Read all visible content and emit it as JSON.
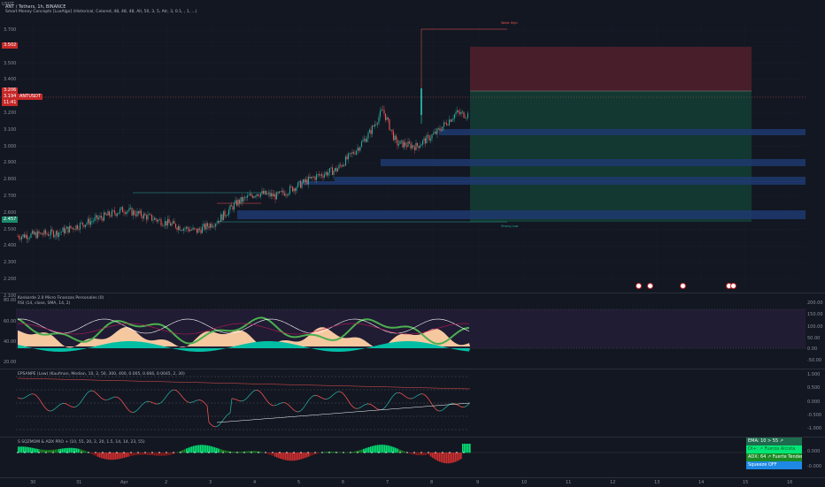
{
  "header": {
    "currency": "USDT",
    "symbol_line": "ANT / Tethers, 1h, BINANCE",
    "indicator_line": "Smart Money Concepts [LuxAlgo] (Historical, Colored, 48, 48, 48, All, 50, 3, 5, Atr, 3, 0.1, , 1, ...)"
  },
  "price_axis": {
    "ticks": [
      "3.700",
      "3.600",
      "3.500",
      "3.400",
      "3.300",
      "3.200",
      "3.100",
      "3.000",
      "2.900",
      "2.800",
      "2.700",
      "2.600",
      "2.500",
      "2.400",
      "2.300",
      "2.200",
      "2.100"
    ],
    "badge_top": "3.502",
    "badge_mid_1": "3.206",
    "badge_current": "3.194",
    "badge_current_sub": "11:41",
    "badge_symbol": "ANTUSDT",
    "badge_low": "2.457"
  },
  "chart_labels": {
    "weak_high": "Weak High",
    "strong_low": "Strong Low"
  },
  "konkorde": {
    "title": "Konkorde 2.0 Micro Finanzas Personales (0)",
    "subtitle": "RSI (14, close, SMA, 14, 2)",
    "left_ticks": [
      "80.00",
      "60.00",
      "40.00",
      "20.00"
    ],
    "right_ticks": [
      "200.00",
      "150.00",
      "100.00",
      "50.00",
      "0.00",
      "-50.00"
    ]
  },
  "epsanpe": {
    "title": "EPSANPE (Low) (Kaufman, Median, 10, 2, 50, 300, 400, 0.005, 0.666, 0.0045, 2, 30)",
    "right_ticks": [
      "1.000",
      "0.500",
      "0.000",
      "-0.500",
      "-1.000"
    ]
  },
  "sqzmom": {
    "title": "S SQZMOM & ADX PRO + (10, 55, 20, 2, 20, 1.5, 14, 14, 23, 55)",
    "right_ticks": [
      "0.000",
      "-0.000"
    ],
    "table": [
      {
        "text": "EMA: 10 > 55 ↗",
        "bg": "#1e6b4e",
        "fg": "#ffffff"
      },
      {
        "text": "DI+: ↗ Fuerza Alcista",
        "bg": "#00e676",
        "fg": "#1b5e20"
      },
      {
        "text": "ADX: 64 ↗ Fuerte Tendencia",
        "bg": "#1b8a24",
        "fg": "#ffffff"
      },
      {
        "text": "Squeeze OFF",
        "bg": "#1e88e5",
        "fg": "#ffffff"
      }
    ]
  },
  "time_axis": {
    "labels": [
      "30",
      "31",
      "Apr",
      "2",
      "3",
      "4",
      "5",
      "6",
      "7",
      "8",
      "9",
      "10",
      "11",
      "12",
      "13",
      "14",
      "15",
      "16"
    ]
  },
  "colors": {
    "bg": "#131722",
    "up": "#26a69a",
    "down": "#ef5350",
    "grid": "#1e222d",
    "ob_blue": "#1e3a6e",
    "sl_zone": "#4a1f2a",
    "tp_zone": "#133a33"
  }
}
